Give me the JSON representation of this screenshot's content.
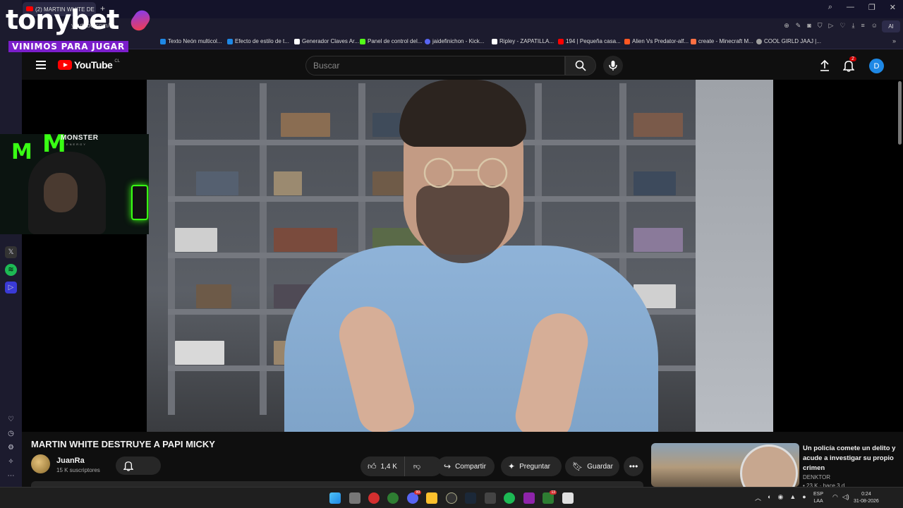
{
  "browser": {
    "tab_title": "(2) MARTIN WHITE DE",
    "url": "youtube.com/",
    "aria_label": "AI"
  },
  "bookmarks": [
    {
      "label": "Texto Neón multicol...",
      "color": "#1e88e5"
    },
    {
      "label": "Efecto de estilo de t...",
      "color": "#1e88e5"
    },
    {
      "label": "Generador Claves Ar...",
      "color": "#ffffff"
    },
    {
      "label": "Panel de control del...",
      "color": "#53fc18"
    },
    {
      "label": "jaidefinichon - Kick...",
      "color": "#5865f2"
    },
    {
      "label": "Ripley - ZAPATILLA...",
      "color": "#ffffff"
    },
    {
      "label": "194 | Pequeña casa...",
      "color": "#ff0000"
    },
    {
      "label": "Alien Vs Predator-alf...",
      "color": "#ff5722"
    },
    {
      "label": "create - Minecraft M...",
      "color": "#ff7043"
    },
    {
      "label": "COOL GIRLD JAAJ |...",
      "color": "#9e9e9e"
    }
  ],
  "overlay": {
    "brand": "tonybet",
    "slogan": "VINIMOS PARA JUGAR",
    "sponsor": "MONSTER",
    "sponsor_sub": "ENERGY"
  },
  "youtube": {
    "logo": "YouTube",
    "region": "CL",
    "search_placeholder": "Buscar",
    "notification_count": "2",
    "user_initial": "D"
  },
  "video": {
    "title": "MARTIN WHITE DESTRUYE A PAPI MICKY",
    "channel": "JuanRa",
    "subscribers": "15 K suscriptores",
    "likes": "1,4 K",
    "share_label": "Compartir",
    "ask_label": "Preguntar",
    "save_label": "Guardar"
  },
  "recommendation": {
    "title": "Un policía comete un delito y acude a investigar su propio crimen",
    "channel": "DENKTOR",
    "meta": "• 23 K · hace 3 d"
  },
  "taskbar": {
    "lang_top": "ESP",
    "lang_bottom": "LAA",
    "time": "0:24",
    "date": "31-08-2026",
    "discord_badge": "99",
    "xbox_badge": "13"
  }
}
